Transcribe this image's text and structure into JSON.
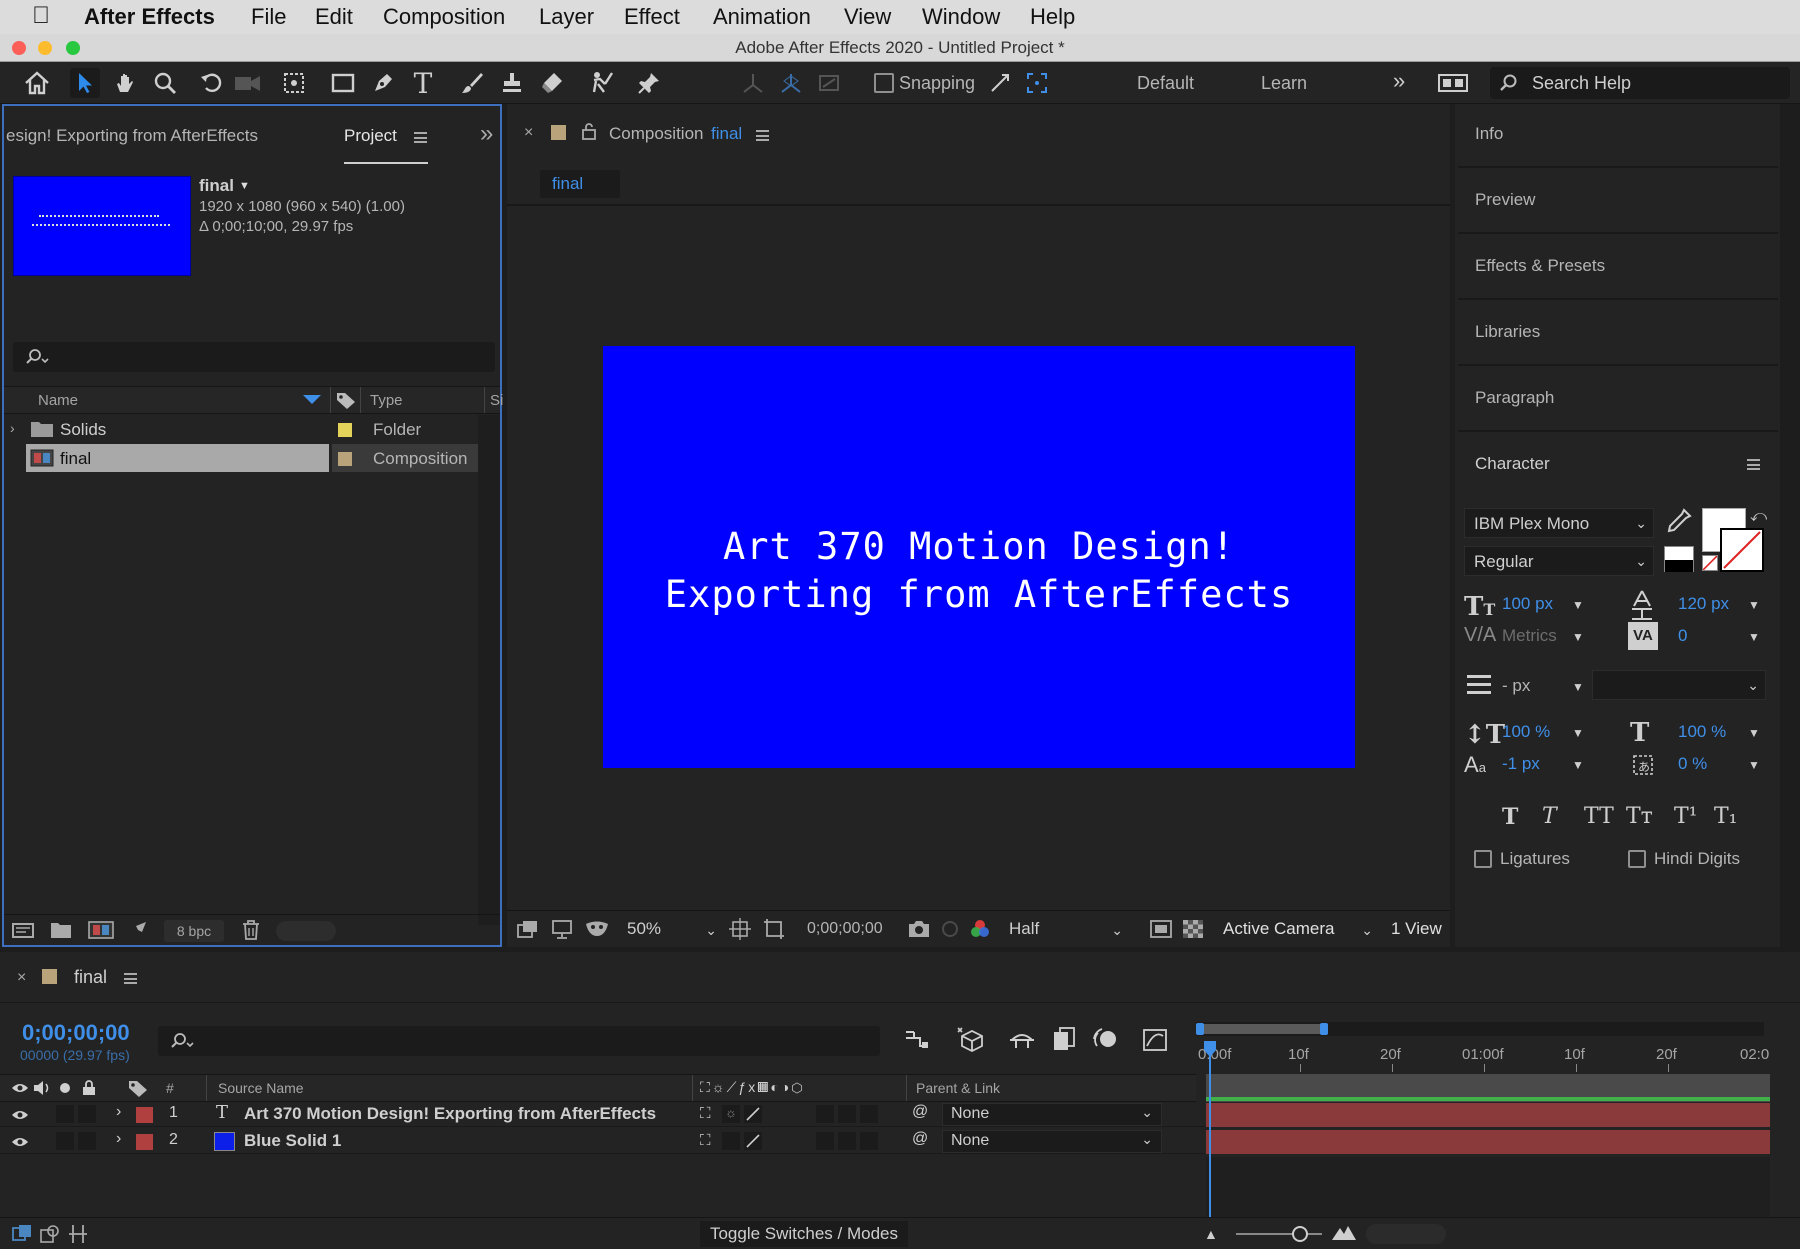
{
  "menubar": {
    "app": "After Effects",
    "items": [
      "File",
      "Edit",
      "Composition",
      "Layer",
      "Effect",
      "Animation",
      "View",
      "Window",
      "Help"
    ]
  },
  "window_title": "Adobe After Effects 2020 - Untitled Project *",
  "toolbar": {
    "snapping": "Snapping",
    "workspace_default": "Default",
    "workspace_learn": "Learn",
    "search_placeholder": "Search Help"
  },
  "project_panel": {
    "tab_label_cut": "esign! Exporting from AfterEffects",
    "tab_project": "Project",
    "preview_name": "final",
    "preview_info_1": "1920 x 1080  (960 x 540) (1.00)",
    "preview_info_2": "Δ 0;00;10;00, 29.97 fps",
    "col_name": "Name",
    "col_type": "Type",
    "col_size_cut": "Si",
    "items": [
      {
        "name": "Solids",
        "type": "Folder",
        "label_color": "#e3d35a"
      },
      {
        "name": "final",
        "type": "Composition",
        "label_color": "#b8a37a"
      }
    ],
    "bpc": "8 bpc"
  },
  "composition_panel": {
    "tab_prefix": "Composition",
    "tab_name": "final",
    "sub_tab": "final",
    "canvas_bg": "#0000ff",
    "canvas_line1": "Art 370 Motion Design!",
    "canvas_line2": "Exporting from AfterEffects",
    "zoom": "50%",
    "timecode": "0;00;00;00",
    "resolution": "Half",
    "camera": "Active Camera",
    "views": "1 View"
  },
  "right_panels": {
    "info": "Info",
    "preview": "Preview",
    "effects": "Effects & Presets",
    "libraries": "Libraries",
    "paragraph": "Paragraph",
    "character": "Character"
  },
  "character": {
    "font": "IBM Plex Mono",
    "style": "Regular",
    "size": "100 px",
    "leading": "120 px",
    "kerning": "Metrics",
    "tracking": "0",
    "stroke": "- px",
    "vscale": "100 %",
    "hscale": "100 %",
    "baseline": "-1 px",
    "tsume": "0 %",
    "ligatures": "Ligatures",
    "hindi_digits": "Hindi Digits",
    "style_buttons": [
      "T",
      "T",
      "TT",
      "Tт",
      "T¹",
      "T₁"
    ]
  },
  "timeline": {
    "comp_name": "final",
    "timecode": "0;00;00;00",
    "frames": "00000 (29.97 fps)",
    "col_source": "Source Name",
    "col_parent": "Parent & Link",
    "col_num": "#",
    "layers": [
      {
        "num": "1",
        "name": "Art 370 Motion Design! Exporting from AfterEffects",
        "type": "text",
        "label_color": "#b0403f",
        "parent": "None"
      },
      {
        "num": "2",
        "name": "Blue Solid 1",
        "type": "solid",
        "label_color": "#b0403f",
        "swatch": "#0b1fe8",
        "parent": "None"
      }
    ],
    "ruler": [
      "0:00f",
      "10f",
      "20f",
      "01:00f",
      "10f",
      "20f",
      "02:0"
    ],
    "toggle": "Toggle Switches / Modes"
  }
}
